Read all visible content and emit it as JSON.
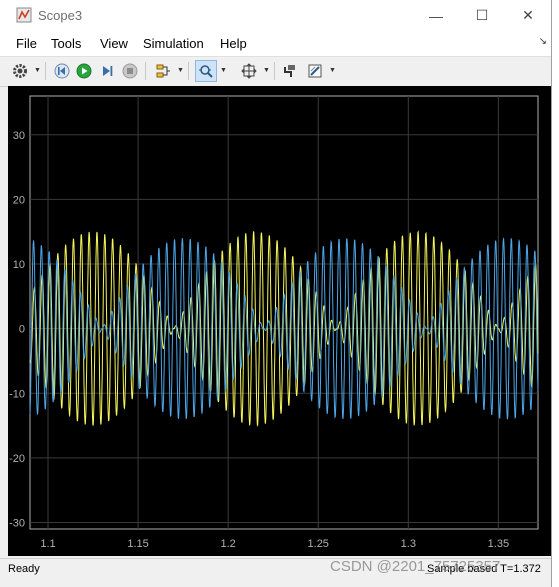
{
  "window": {
    "title": "Scope3"
  },
  "menu": [
    "File",
    "Tools",
    "View",
    "Simulation",
    "Help"
  ],
  "toolbar": {
    "icons": [
      "gear-icon",
      "step-back-icon",
      "run-icon",
      "step-forward-icon",
      "stop-icon",
      "signal-selector-icon",
      "zoom-icon",
      "fit-to-view-icon",
      "style-icon",
      "parameters-icon"
    ]
  },
  "status": {
    "left": "Ready",
    "right": "Sample based  T=1.372"
  },
  "watermark": "CSDN @2201_75725357",
  "colors": {
    "series1": "#f7f75a",
    "series2": "#4da6e8",
    "background": "#000000",
    "grid": "#3a3a3a"
  },
  "chart_data": {
    "type": "line",
    "title": "",
    "xlabel": "",
    "ylabel": "",
    "xlim": [
      1.09,
      1.372
    ],
    "ylim": [
      -31,
      36
    ],
    "xticks": [
      1.1,
      1.15,
      1.2,
      1.25,
      1.3,
      1.35
    ],
    "yticks": [
      -30,
      -20,
      -10,
      0,
      10,
      20,
      30
    ],
    "xtick_labels": [
      "1.1",
      "1.15",
      "1.2",
      "1.25",
      "1.3",
      "1.35"
    ],
    "ytick_labels": [
      "-30",
      "-20",
      "-10",
      "0",
      "10",
      "20",
      "30"
    ],
    "grid": true,
    "series": [
      {
        "name": "",
        "color": "#f7f75a",
        "envelope_peaks_x": [
          1.125,
          1.215,
          1.305
        ],
        "peak_amplitude": 15,
        "carrier_cycles_per_unit": 230
      },
      {
        "name": "",
        "color": "#4da6e8",
        "envelope_peaks_x": [
          1.085,
          1.175,
          1.265,
          1.355
        ],
        "peak_amplitude": 14,
        "carrier_cycles_per_unit": 230
      }
    ]
  }
}
